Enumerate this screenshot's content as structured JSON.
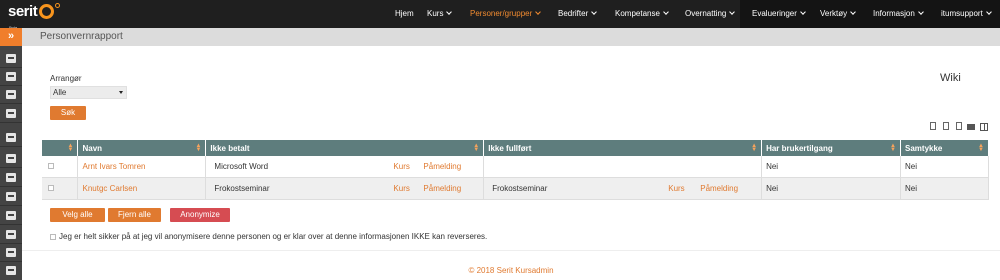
{
  "brand": {
    "logo": "serit",
    "sub": "Bodø"
  },
  "nav": [
    {
      "label": "Hjem"
    },
    {
      "label": "Kurs"
    },
    {
      "label": "Personer/grupper"
    },
    {
      "label": "Bedrifter"
    },
    {
      "label": "Kompetanse"
    },
    {
      "label": "Overnatting"
    },
    {
      "label": "Evalueringer"
    },
    {
      "label": "Verktøy"
    },
    {
      "label": "Informasjon"
    },
    {
      "label": "itumsupport"
    }
  ],
  "sidebar": {
    "toggle": "»",
    "icons": [
      "calendar-icon",
      "calendar-grid-icon",
      "printer-icon",
      "computer-icon",
      "users-icon",
      "user-add-icon",
      "checkbox-icon",
      "clock-icon",
      "document-icon",
      "report-icon",
      "list-icon",
      "book-icon",
      "file-icon"
    ]
  },
  "page": {
    "title": "Personvernrapport"
  },
  "filter": {
    "label": "Arrangør",
    "selected": "Alle",
    "search_button": "Søk"
  },
  "wiki": "Wiki",
  "toolbar": [
    "pdf-icon",
    "excel-icon",
    "pdf-export-icon",
    "print-icon",
    "columns-icon"
  ],
  "table": {
    "headers": [
      "Navn",
      "Ikke betalt",
      "Ikke fullført",
      "Har brukertilgang",
      "Samtykke"
    ],
    "rows": [
      {
        "name": "Arnt Ivars Tomren",
        "ikke_betalt": "Microsoft Word",
        "kurs1": "Kurs",
        "pamelding1": "Påmelding",
        "ikke_fullfort": "",
        "kurs2": "",
        "pamelding2": "",
        "tilgang": "Nei",
        "samtykke": "Nei"
      },
      {
        "name": "Knutgc Carlsen",
        "ikke_betalt": "Frokostseminar",
        "kurs1": "Kurs",
        "pamelding1": "Påmelding",
        "ikke_fullfort": "Frokostseminar",
        "kurs2": "Kurs",
        "pamelding2": "Påmelding",
        "tilgang": "Nei",
        "samtykke": "Nei"
      }
    ]
  },
  "actions": {
    "select_all": "Velg alle",
    "remove_all": "Fjern alle",
    "anonymize": "Anonymize"
  },
  "confirm_text": "Jeg er helt sikker på at jeg vil anonymisere denne personen og er klar over at denne informasjonen IKKE kan reverseres.",
  "footer": "© 2018 Serit Kursadmin",
  "colors": {
    "accent": "#e07a30",
    "header": "#5e7d7d",
    "danger": "#d64c52"
  }
}
